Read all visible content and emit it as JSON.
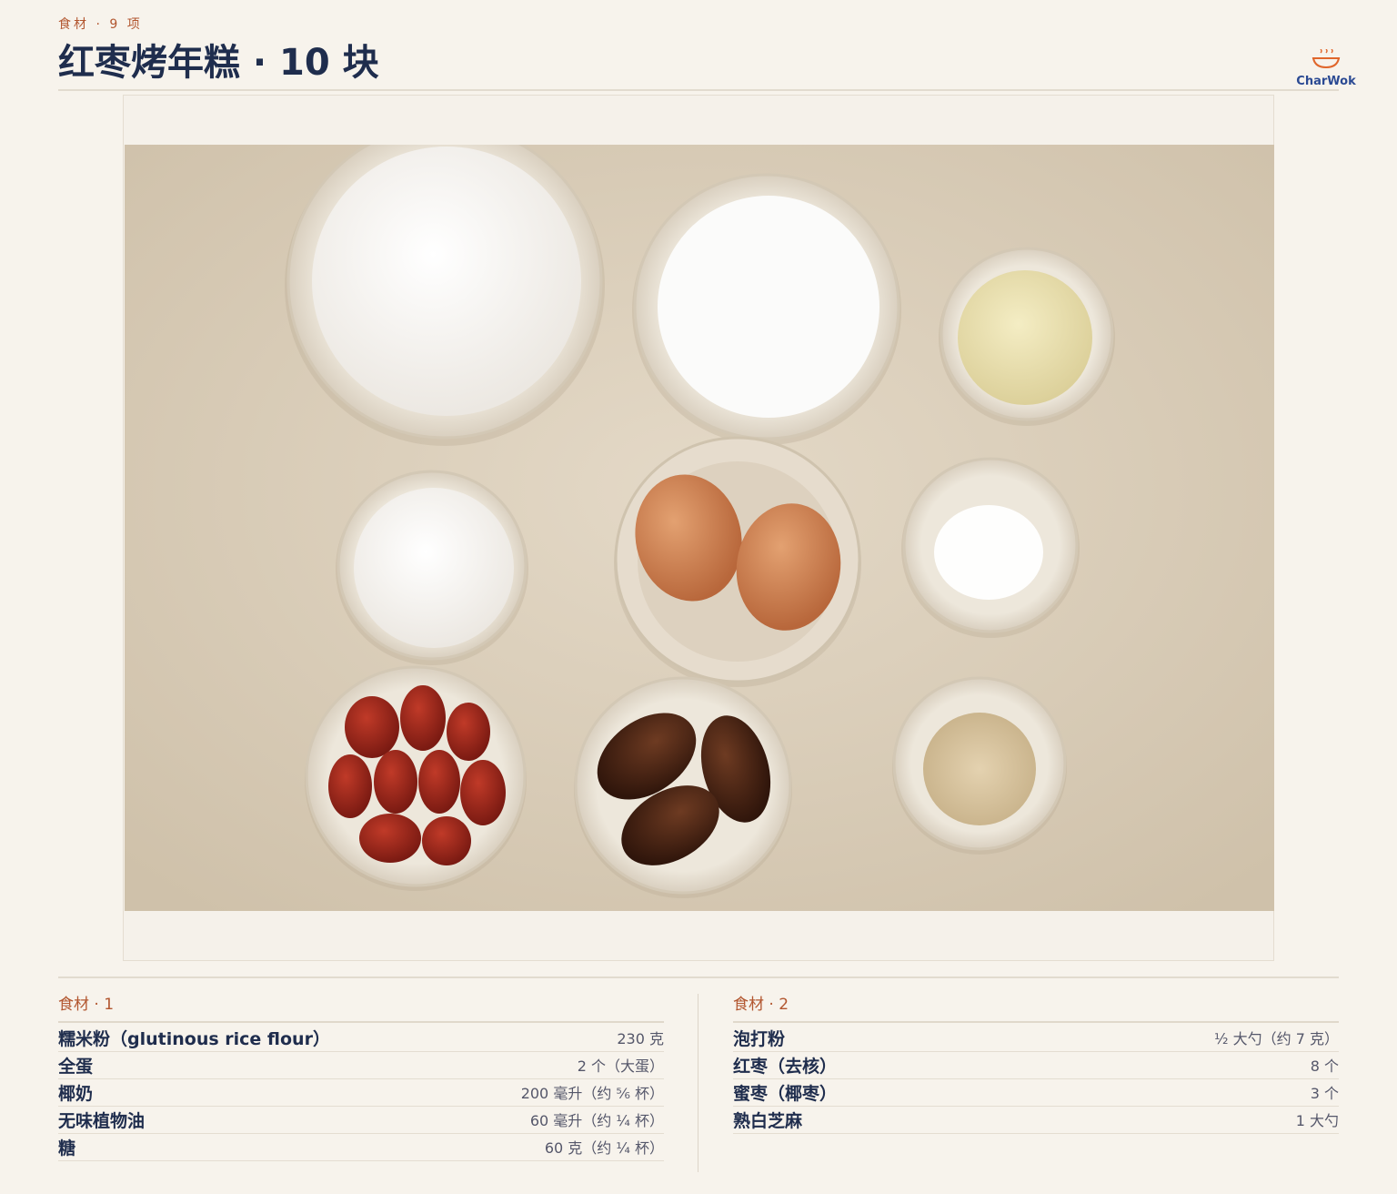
{
  "header": {
    "eyebrow": "食材 · 9 项",
    "title": "红枣烤年糕 · 10 块"
  },
  "logo": {
    "text": "CharWok",
    "icon": "steaming-wok-icon",
    "color": "#2b4a93",
    "accent": "#e0662b"
  },
  "photo": {
    "alt": "ingredient flat-lay"
  },
  "colors": {
    "accent": "#b2562f",
    "ink": "#1f2d4d",
    "background": "#f7f3ec"
  },
  "ingredients": {
    "group1": {
      "heading": "食材 · 1",
      "items": [
        {
          "name": "糯米粉（glutinous rice flour）",
          "qty": "230 克"
        },
        {
          "name": "全蛋",
          "qty": "2 个（大蛋）"
        },
        {
          "name": "椰奶",
          "qty": "200 毫升（约 ⅚ 杯）"
        },
        {
          "name": "无味植物油",
          "qty": "60 毫升（约 ¼ 杯）"
        },
        {
          "name": "糖",
          "qty": "60 克（约 ¼ 杯）"
        }
      ]
    },
    "group2": {
      "heading": "食材 · 2",
      "items": [
        {
          "name": "泡打粉",
          "qty": "½ 大勺（约 7 克）"
        },
        {
          "name": "红枣（去核）",
          "qty": "8 个"
        },
        {
          "name": "蜜枣（椰枣）",
          "qty": "3 个"
        },
        {
          "name": "熟白芝麻",
          "qty": "1 大勺"
        }
      ]
    }
  }
}
